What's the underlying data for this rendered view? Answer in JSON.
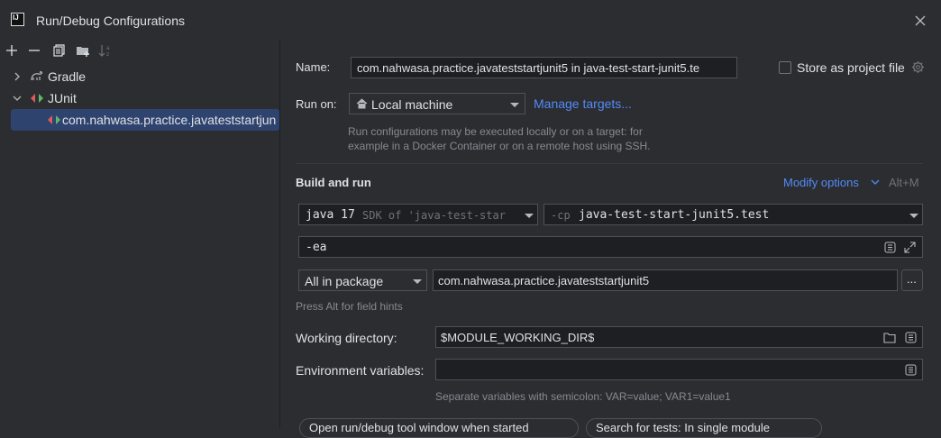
{
  "window": {
    "title": "Run/Debug Configurations"
  },
  "toolbar": {
    "icons": [
      "add-icon",
      "remove-icon",
      "copy-icon",
      "new-folder-icon",
      "sort-icon"
    ]
  },
  "tree": {
    "items": [
      {
        "label": "Gradle",
        "expanded": false
      },
      {
        "label": "JUnit",
        "expanded": true
      },
      {
        "label": "com.nahwasa.practice.javateststartjun",
        "selected": true
      }
    ]
  },
  "form": {
    "name_label": "Name:",
    "name_value": "com.nahwasa.practice.javateststartjunit5 in java-test-start-junit5.te",
    "store_label": "Store as project file",
    "run_on_label": "Run on:",
    "run_on_value": "Local machine",
    "manage_targets": "Manage targets...",
    "run_on_hint": "Run configurations may be executed locally or on a target: for example in a Docker Container or on a remote host using SSH.",
    "build_run_title": "Build and run",
    "modify_options": "Modify options",
    "modify_shortcut": "Alt+M",
    "jdk_main": "java 17",
    "jdk_sub": "SDK of 'java-test-star",
    "cp_prefix": "-cp",
    "cp_value": "java-test-start-junit5.test",
    "vm_options": "-ea",
    "test_kind": "All in package",
    "package_value": "com.nahwasa.practice.javateststartjunit5",
    "ellipsis": "...",
    "alt_hint": "Press Alt for field hints",
    "workdir_label": "Working directory:",
    "workdir_value": "$MODULE_WORKING_DIR$",
    "env_label": "Environment variables:",
    "env_value": "",
    "env_hint": "Separate variables with semicolon: VAR=value; VAR1=value1",
    "bottom_btn1": "Open run/debug tool window when started",
    "bottom_btn2": "Search for tests: In single module"
  },
  "colors": {
    "accent": "#548af7",
    "selection": "#2e436e",
    "bg": "#2b2d30",
    "field_bg": "#1e1f22"
  }
}
